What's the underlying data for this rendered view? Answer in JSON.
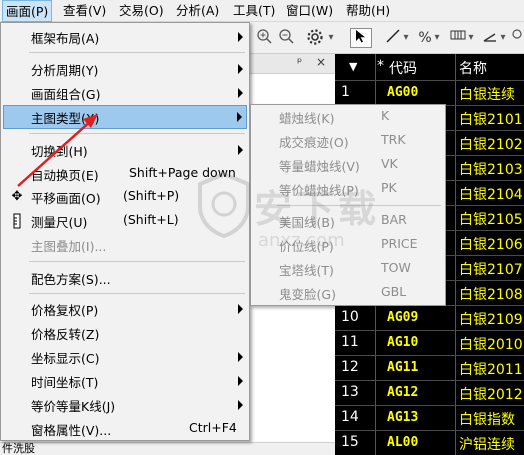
{
  "menubar": [
    {
      "label": "画面(P)",
      "active": true
    },
    {
      "label": "查看(V)"
    },
    {
      "label": "交易(O)"
    },
    {
      "label": "分析(A)"
    },
    {
      "label": "工具(T)"
    },
    {
      "label": "窗口(W)"
    },
    {
      "label": "帮助(H)"
    }
  ],
  "toolbar": {
    "icons": [
      "zoom-in-icon",
      "zoom-out-icon",
      "gear-icon",
      "chevron-down-icon",
      "pointer-icon",
      "line-icon",
      "percent-icon",
      "grid-icon",
      "drawing-icon",
      "zoom-small-icon"
    ],
    "pin_glyph": "ᵖ",
    "close_glyph": "×"
  },
  "menu": {
    "items": [
      {
        "label": "框架布局(A)",
        "submenu": true
      },
      {
        "label": "分析周期(Y)",
        "submenu": true
      },
      {
        "label": "画面组合(G)",
        "submenu": true
      },
      {
        "label": "主图类型(X)",
        "submenu": true,
        "highlighted": true
      },
      {
        "label": "切换到(H)",
        "submenu": true
      },
      {
        "label": "自动换页(E)",
        "shortcut": "Shift+Page down"
      },
      {
        "label": "平移画面(O)",
        "shortcut": "(Shift+P)",
        "icon": "move-icon"
      },
      {
        "label": "测量尺(U)",
        "shortcut": "(Shift+L)",
        "icon": "ruler-icon"
      },
      {
        "label": "主图叠加(I)...",
        "disabled": true
      },
      {
        "label": "配色方案(S)..."
      },
      {
        "label": "价格复权(P)",
        "submenu": true
      },
      {
        "label": "价格反转(Z)"
      },
      {
        "label": "坐标显示(C)",
        "submenu": true
      },
      {
        "label": "时间坐标(T)",
        "submenu": true
      },
      {
        "label": "等价等量K线(J)",
        "submenu": true
      },
      {
        "label": "窗格属性(V)...",
        "shortcut": "Ctrl+F4"
      }
    ]
  },
  "submenu": {
    "items": [
      {
        "label": "蜡烛线(K)",
        "shortcut": "K"
      },
      {
        "label": "成交痕迹(O)",
        "shortcut": "TRK"
      },
      {
        "label": "等量蜡烛线(V)",
        "shortcut": "VK"
      },
      {
        "label": "等价蜡烛线(P)",
        "shortcut": "PK"
      },
      {
        "label": "美国线(B)",
        "shortcut": "BAR"
      },
      {
        "label": "价位线(P)",
        "shortcut": "PRICE"
      },
      {
        "label": "宝塔线(T)",
        "shortcut": "TOW"
      },
      {
        "label": "鬼变脸(G)",
        "shortcut": "GBL"
      }
    ]
  },
  "table": {
    "headers": {
      "arrow": "▼",
      "star": "*",
      "code": "代码",
      "name": "名称"
    },
    "rows": [
      {
        "n": "1",
        "code": "AG00",
        "name": "白银连续"
      },
      {
        "n": "2",
        "code": "AG01",
        "name": "白银2101"
      },
      {
        "n": "3",
        "code": "AG02",
        "name": "白银2102"
      },
      {
        "n": "4",
        "code": "AG03",
        "name": "白银2103"
      },
      {
        "n": "5",
        "code": "AG04",
        "name": "白银2104"
      },
      {
        "n": "6",
        "code": "AG05",
        "name": "白银2105"
      },
      {
        "n": "7",
        "code": "AG06",
        "name": "白银2106"
      },
      {
        "n": "8",
        "code": "AG07",
        "name": "白银2107"
      },
      {
        "n": "9",
        "code": "AG08",
        "name": "白银2108"
      },
      {
        "n": "10",
        "code": "AG09",
        "name": "白银2109"
      },
      {
        "n": "11",
        "code": "AG10",
        "name": "白银2010"
      },
      {
        "n": "12",
        "code": "AG11",
        "name": "白银2011"
      },
      {
        "n": "13",
        "code": "AG12",
        "name": "白银2012"
      },
      {
        "n": "14",
        "code": "AG13",
        "name": "白银指数"
      },
      {
        "n": "15",
        "code": "AL00",
        "name": "沪铝连续"
      }
    ]
  },
  "statusbar": {
    "text": "件洗股"
  },
  "watermark": {
    "text": "安下载",
    "sub": "anxz.com"
  },
  "colors": {
    "highlight": "#9ec9ef",
    "quote_bg": "#000000",
    "quote_text": "#ffff00",
    "arrow": "#e02020"
  }
}
